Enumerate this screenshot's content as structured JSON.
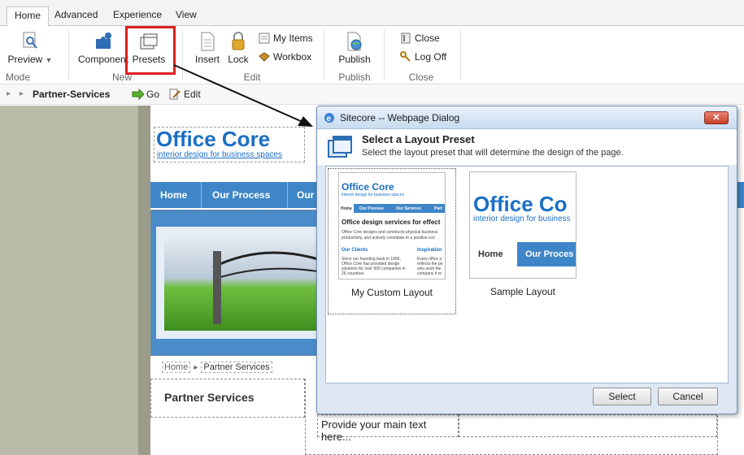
{
  "ribbon": {
    "tabs": [
      "Home",
      "Advanced",
      "Experience",
      "View"
    ],
    "preview_label": "Preview",
    "mode_label": "Mode",
    "component_label": "Component",
    "presets_label": "Presets",
    "new_label": "New",
    "insert_label": "Insert",
    "lock_label": "Lock",
    "my_items_label": "My Items",
    "workbox_label": "Workbox",
    "edit_group_label": "Edit",
    "publish_label": "Publish",
    "publish_group_label": "Publish",
    "close_label": "Close",
    "logoff_label": "Log Off",
    "close_group_label": "Close"
  },
  "breadcrumb": {
    "current": "Partner-Services",
    "go_label": "Go",
    "edit_label": "Edit"
  },
  "page": {
    "logo_title": "Office Core",
    "logo_tagline": "interior design for business spaces",
    "nav": [
      "Home",
      "Our Process",
      "Our"
    ],
    "crumb_home": "Home",
    "crumb_current": "Partner Services",
    "section_title": "Partner Services",
    "main_text_placeholder": "Provide your main text here..."
  },
  "dialog": {
    "window_title": "Sitecore -- Webpage Dialog",
    "heading": "Select a Layout Preset",
    "subheading": "Select the layout preset that will determine the design of the page.",
    "presets": [
      {
        "name": "My Custom Layout",
        "thumb_title": "Office Core",
        "thumb_tagline": "interior design for business spaces",
        "thumb_nav": [
          "Home",
          "Our Process",
          "Our Services",
          "Part"
        ],
        "thumb_heading": "Office design services for effect",
        "thumb_text": "Office Core designs and constructs physical business productivity, and actively contribute to a positive con",
        "thumb_col1_title": "Our Clients",
        "thumb_col1_text": "Since our founding back in 1996, Office Core has provided design solutions for over 500 companies in 26 countries.",
        "thumb_col2_title": "Inspiration",
        "thumb_col2_text": "Every office a reflects the pe who work the company it re"
      },
      {
        "name": "Sample Layout",
        "thumb_title": "Office Co",
        "thumb_tagline": "interior design for business",
        "thumb_nav": [
          "Home",
          "Our Proces"
        ]
      }
    ],
    "select_label": "Select",
    "cancel_label": "Cancel"
  },
  "colors": {
    "accent": "#1a6fc4",
    "nav": "#3f86c8",
    "highlight_box": "#e02020"
  }
}
